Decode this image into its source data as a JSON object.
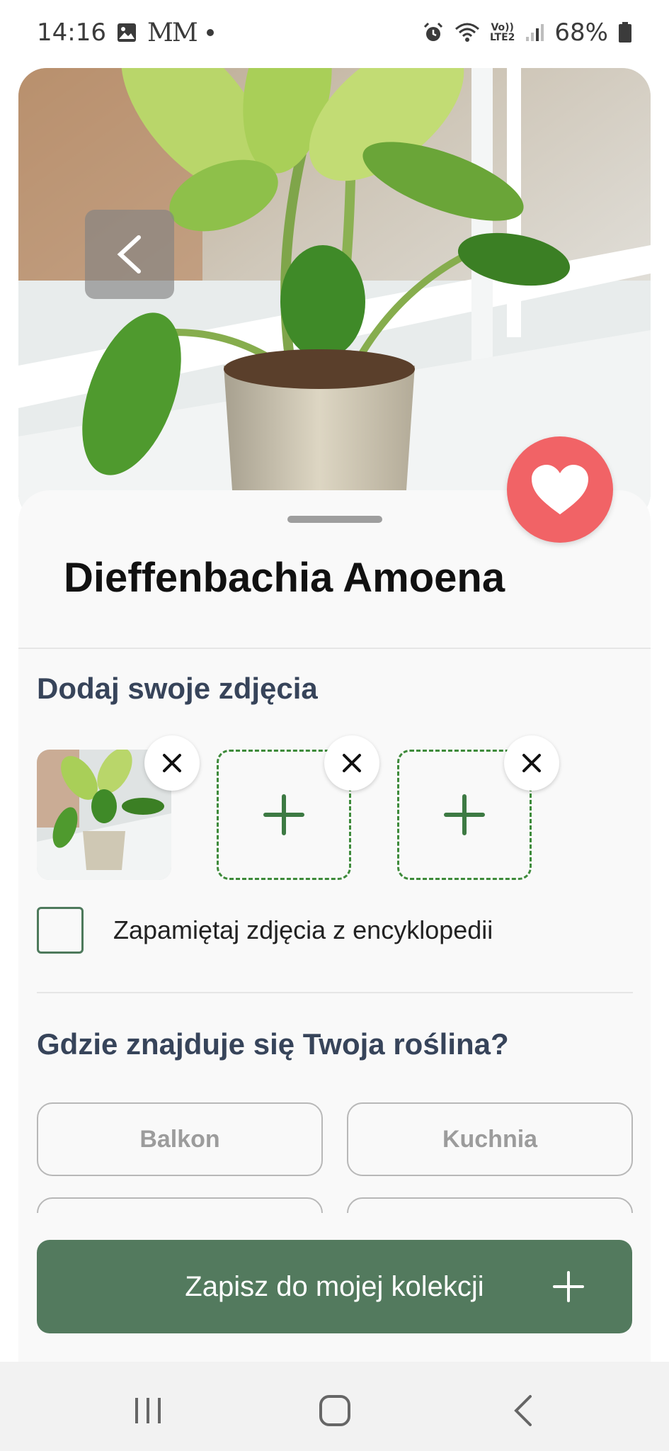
{
  "status_bar": {
    "time": "14:16",
    "notif_text": "MM",
    "volte_line1": "Vo))",
    "volte_line2": "LTE2",
    "battery": "68%"
  },
  "plant": {
    "name": "Dieffenbachia Amoena"
  },
  "photos": {
    "section_title": "Dodaj swoje zdjęcia",
    "remember_label": "Zapamiętaj zdjęcia z encyklopedii",
    "remember_checked": false
  },
  "location": {
    "section_title": "Gdzie znajduje się Twoja roślina?",
    "options": [
      "Balkon",
      "Kuchnia"
    ]
  },
  "actions": {
    "save_label": "Zapisz do mojej kolekcji"
  },
  "colors": {
    "accent_green": "#537a5e",
    "favorite_red": "#f16366",
    "heading_navy": "#37445a"
  }
}
